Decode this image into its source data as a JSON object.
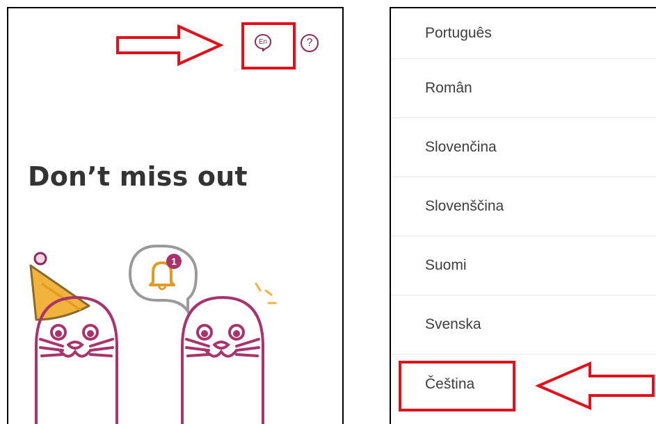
{
  "left_screen": {
    "heading": "Don’t miss out",
    "language_button": {
      "label": "En",
      "icon": "speech-bubble-icon"
    },
    "help_button": {
      "label": "?",
      "icon": "help-icon"
    },
    "notification_badge": "1"
  },
  "right_screen": {
    "languages": [
      "Português",
      "Român",
      "Slovenčina",
      "Slovenščina",
      "Suomi",
      "Svenska",
      "Čeština"
    ]
  },
  "annotations": {
    "highlight_color": "#e2101a",
    "arrow_color": "#e2101a"
  },
  "colors": {
    "brand": "#8b2a5a",
    "text": "#333333",
    "divider": "#e6e6e6",
    "party_hat": "#f2b33d"
  }
}
